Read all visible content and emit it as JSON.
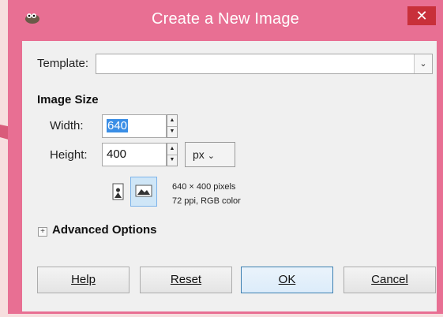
{
  "window": {
    "title": "Create a New Image",
    "close_glyph": "✕",
    "app_icon": "gimp-wilber-icon"
  },
  "template": {
    "label": "Template:",
    "value": ""
  },
  "image_size": {
    "heading": "Image Size",
    "width_label": "Width:",
    "width_value": "640",
    "height_label": "Height:",
    "height_value": "400",
    "unit": "px",
    "info_line1": "640 × 400 pixels",
    "info_line2": "72 ppi, RGB color"
  },
  "advanced": {
    "expander_glyph": "+",
    "label": "Advanced Options"
  },
  "buttons": {
    "help": "Help",
    "reset": "Reset",
    "ok": "OK",
    "cancel": "Cancel"
  },
  "colors": {
    "titlebar": "#e86f93",
    "accent_selection": "#3a8ee6"
  }
}
